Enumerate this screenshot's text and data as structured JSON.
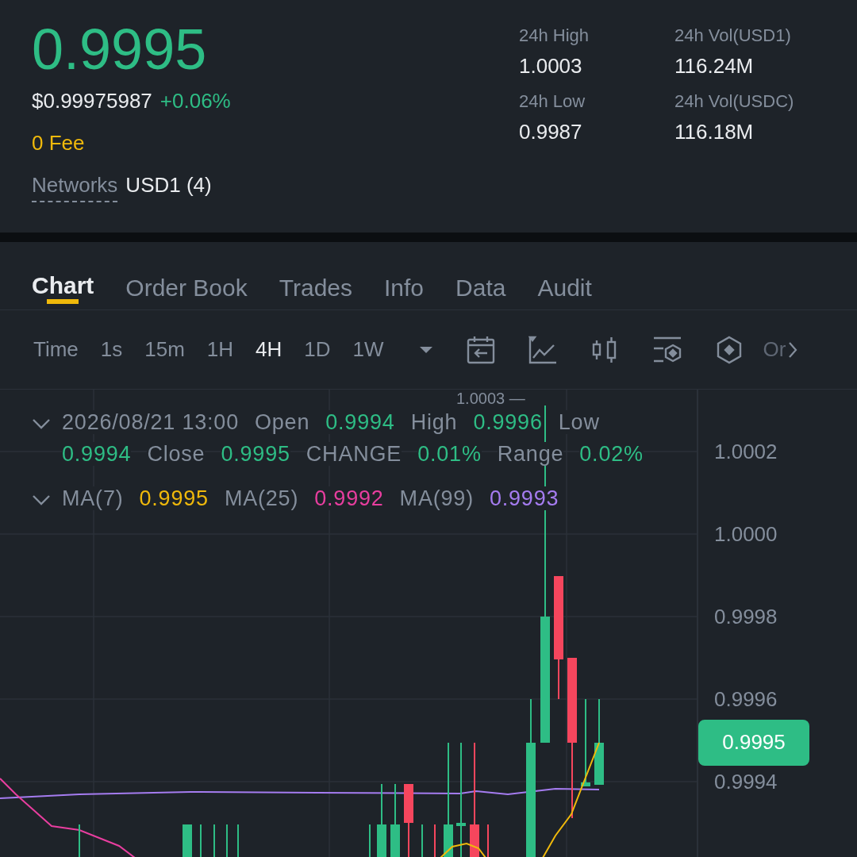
{
  "ticker": {
    "price": "0.9995",
    "usd_price": "$0.99975987",
    "change": "+0.06%",
    "fee": "0 Fee",
    "networks_label": "Networks",
    "networks_value": "USD1 (4)"
  },
  "stats": [
    {
      "label": "24h High",
      "value": "1.0003"
    },
    {
      "label": "24h Vol(USD1)",
      "value": "116.24M"
    },
    {
      "label": "24h Low",
      "value": "0.9987"
    },
    {
      "label": "24h Vol(USDC)",
      "value": "116.18M"
    }
  ],
  "tabs": [
    {
      "label": "Chart",
      "selected": true
    },
    {
      "label": "Order Book",
      "selected": false
    },
    {
      "label": "Trades",
      "selected": false
    },
    {
      "label": "Info",
      "selected": false
    },
    {
      "label": "Data",
      "selected": false
    },
    {
      "label": "Audit",
      "selected": false
    }
  ],
  "toolbar": {
    "time_label": "Time",
    "intervals": [
      {
        "label": "1s",
        "selected": false
      },
      {
        "label": "15m",
        "selected": false
      },
      {
        "label": "1H",
        "selected": false
      },
      {
        "label": "4H",
        "selected": true
      },
      {
        "label": "1D",
        "selected": false
      },
      {
        "label": "1W",
        "selected": false
      }
    ],
    "more_label": "Or"
  },
  "chart": {
    "ohlc_legend": [
      {
        "text": "2026/08/21 13:00",
        "kind": "label"
      },
      {
        "text": "Open",
        "kind": "label"
      },
      {
        "text": "0.9994",
        "kind": "value"
      },
      {
        "text": "High",
        "kind": "label"
      },
      {
        "text": "0.9996",
        "kind": "value"
      },
      {
        "text": "Low",
        "kind": "label"
      },
      {
        "text": "0.9994",
        "kind": "value"
      },
      {
        "text": "Close",
        "kind": "label"
      },
      {
        "text": "0.9995",
        "kind": "value"
      },
      {
        "text": "CHANGE",
        "kind": "label"
      },
      {
        "text": "0.01%",
        "kind": "value"
      },
      {
        "text": "Range",
        "kind": "label"
      },
      {
        "text": "0.02%",
        "kind": "value"
      }
    ],
    "ma_legend": [
      {
        "label": "MA(7)",
        "value": "0.9995",
        "color": "#f0b90b"
      },
      {
        "label": "MA(25)",
        "value": "0.9992",
        "color": "#e83e9f"
      },
      {
        "label": "MA(99)",
        "value": "0.9993",
        "color": "#a57cf0"
      }
    ],
    "high_marker": "1.0003 —",
    "price_axis": [
      "1.0002",
      "1.0000",
      "0.9998",
      "0.9996",
      "0.9994"
    ],
    "last_price": "0.9995"
  }
}
